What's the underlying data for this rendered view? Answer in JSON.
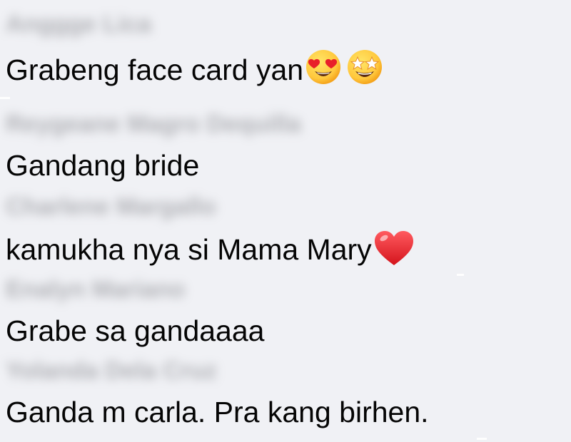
{
  "comments": [
    {
      "author": "Anggge Lica",
      "text": "Grabeng face card yan",
      "emojis": [
        "heart-eyes-face-icon",
        "star-struck-face-icon"
      ]
    },
    {
      "author": "Reygeane Magro Dequilla",
      "text": "Gandang bride",
      "emojis": []
    },
    {
      "author": "Charlene Margallo",
      "text": "kamukha nya si Mama Mary",
      "emojis": [
        "red-heart-icon"
      ]
    },
    {
      "author": "Enalyn Mariano",
      "text": "Grabe sa gandaaaa",
      "emojis": []
    },
    {
      "author": "Yolanda Dela Cruz",
      "text": "Ganda m carla. Pra kang birhen.",
      "emojis": []
    }
  ],
  "colors": {
    "background": "#f0f1f5",
    "text": "#050505",
    "author_blur": "#7a7b80",
    "heart": "#e8202a",
    "emoji_face": "#ffc83d"
  }
}
